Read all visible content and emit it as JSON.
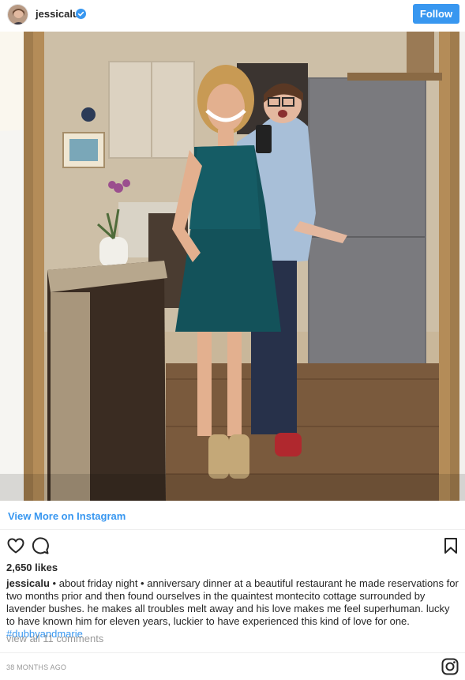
{
  "header": {
    "username": "jessicalu",
    "follow_label": "Follow"
  },
  "icons": {
    "avatar": "avatar",
    "verified": "verified-badge-icon",
    "like": "heart-icon",
    "comment": "comment-icon",
    "save": "bookmark-icon",
    "instagram": "instagram-icon"
  },
  "colors": {
    "accent": "#3897f0",
    "text": "#262626",
    "muted": "#999999"
  },
  "post": {
    "view_more_label": "View More on Instagram",
    "likes": "2,650 likes",
    "caption_user": "jessicalu",
    "caption_text": " • about friday night • anniversary dinner at a beautiful restaurant he made reservations for two months prior and then found ourselves in the quaintest montecito cottage surrounded by lavender bushes. he makes all troubles melt away and his love makes me feel superhuman. lucky to have known him for eleven years, luckier to have experienced this kind of love for one. ",
    "hashtag": "#dubbyandmarie",
    "comments_link": "view all 11 comments",
    "timestamp": "38 MONTHS AGO"
  }
}
